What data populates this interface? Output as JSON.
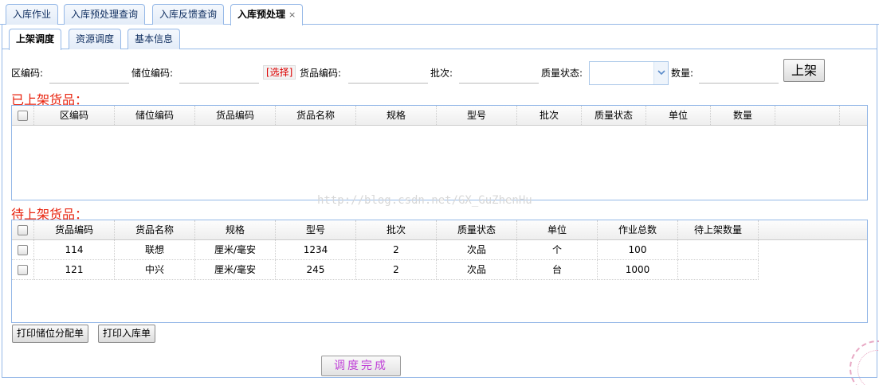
{
  "outer_tabs": [
    "入库作业",
    "入库预处理查询",
    "入库反馈查询",
    "入库预处理"
  ],
  "outer_tab_close": "×",
  "inner_tabs": [
    "上架调度",
    "资源调度",
    "基本信息"
  ],
  "form": {
    "zone_label": "区编码:",
    "slot_label": "储位编码:",
    "select_link": "[选择]",
    "goods_label": "货品编码:",
    "batch_label": "批次:",
    "quality_label": "质量状态:",
    "quantity_label": "数量:",
    "shelf_button": "上架"
  },
  "shelved": {
    "title": "已上架货品：",
    "columns": [
      "区编码",
      "储位编码",
      "货品编码",
      "货品名称",
      "规格",
      "型号",
      "批次",
      "质量状态",
      "单位",
      "数量"
    ]
  },
  "pending": {
    "title": "待上架货品：",
    "columns": [
      "货品编码",
      "货品名称",
      "规格",
      "型号",
      "批次",
      "质量状态",
      "单位",
      "作业总数",
      "待上架数量"
    ],
    "rows": [
      [
        "114",
        "联想",
        "厘米/毫安",
        "1234",
        "2",
        "次品",
        "个",
        "100",
        ""
      ],
      [
        "121",
        "中兴",
        "厘米/毫安",
        "245",
        "2",
        "次品",
        "台",
        "1000",
        ""
      ]
    ]
  },
  "buttons": {
    "print_slot": "打印储位分配单",
    "print_inbound": "打印入库单",
    "done": "调度完成"
  },
  "watermark": "http://blog.csdn.net/GX_GuZhenHu",
  "colors": {
    "accent": "#95b8e7",
    "section_title": "#e8230e",
    "done_text": "#c040d8"
  },
  "icons": {
    "combo_arrow": "chevron-down-icon"
  }
}
